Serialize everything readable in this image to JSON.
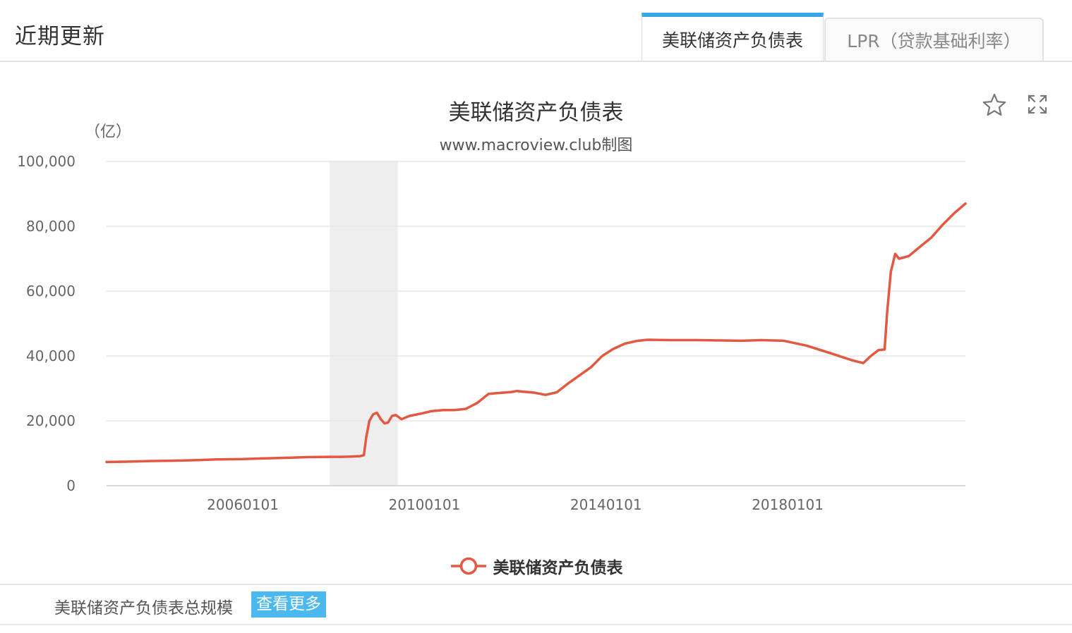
{
  "header": {
    "title": "近期更新",
    "tabs": [
      {
        "label": "美联储资产负债表",
        "active": true
      },
      {
        "label": "LPR（贷款基础利率）",
        "active": false
      }
    ],
    "accent_color": "#3aa6ea"
  },
  "toolbar": {
    "favorite_icon": "star-icon",
    "fullscreen_icon": "expand-icon"
  },
  "chart_data": {
    "type": "line",
    "title": "美联储资产负债表",
    "subtitle": "www.macroview.club制图",
    "unit_label": "（亿）",
    "ylim": [
      0,
      100000
    ],
    "yticks": [
      "100,000",
      "80,000",
      "60,000",
      "40,000",
      "20,000",
      "0"
    ],
    "ytick_values": [
      100000,
      80000,
      60000,
      40000,
      20000,
      0
    ],
    "xlim": [
      "2003-01-01",
      "2021-12-01"
    ],
    "xticks": [
      {
        "label": "20060101",
        "date": "2006-01-01"
      },
      {
        "label": "20100101",
        "date": "2010-01-01"
      },
      {
        "label": "20140101",
        "date": "2014-01-01"
      },
      {
        "label": "20180101",
        "date": "2018-01-01"
      }
    ],
    "shaded_period": {
      "start": "2007-12-01",
      "end": "2009-06-01",
      "color": "#eeeeee"
    },
    "grid": true,
    "series": [
      {
        "name": "美联储资产负债表",
        "color": "#e25841",
        "points": [
          [
            "2003-01-01",
            7300
          ],
          [
            "2003-06-01",
            7400
          ],
          [
            "2004-01-01",
            7600
          ],
          [
            "2004-06-01",
            7700
          ],
          [
            "2005-01-01",
            7900
          ],
          [
            "2005-06-01",
            8100
          ],
          [
            "2006-01-01",
            8200
          ],
          [
            "2006-06-01",
            8400
          ],
          [
            "2007-01-01",
            8600
          ],
          [
            "2007-06-01",
            8800
          ],
          [
            "2007-12-01",
            8900
          ],
          [
            "2008-03-01",
            8900
          ],
          [
            "2008-06-01",
            9000
          ],
          [
            "2008-08-01",
            9100
          ],
          [
            "2008-09-01",
            9400
          ],
          [
            "2008-09-20",
            15000
          ],
          [
            "2008-10-15",
            20000
          ],
          [
            "2008-11-15",
            22000
          ],
          [
            "2008-12-15",
            22500
          ],
          [
            "2009-01-15",
            20500
          ],
          [
            "2009-02-15",
            19200
          ],
          [
            "2009-03-15",
            19500
          ],
          [
            "2009-04-15",
            21500
          ],
          [
            "2009-05-15",
            21800
          ],
          [
            "2009-07-01",
            20500
          ],
          [
            "2009-09-01",
            21500
          ],
          [
            "2009-12-01",
            22200
          ],
          [
            "2010-03-01",
            23000
          ],
          [
            "2010-06-01",
            23300
          ],
          [
            "2010-09-01",
            23300
          ],
          [
            "2010-12-01",
            23700
          ],
          [
            "2011-03-01",
            25500
          ],
          [
            "2011-06-01",
            28300
          ],
          [
            "2011-09-01",
            28600
          ],
          [
            "2011-12-01",
            28900
          ],
          [
            "2012-01-15",
            29200
          ],
          [
            "2012-03-01",
            29000
          ],
          [
            "2012-06-01",
            28700
          ],
          [
            "2012-09-01",
            28000
          ],
          [
            "2012-12-01",
            28800
          ],
          [
            "2013-03-01",
            31500
          ],
          [
            "2013-06-01",
            34000
          ],
          [
            "2013-09-01",
            36500
          ],
          [
            "2013-12-01",
            40000
          ],
          [
            "2014-03-01",
            42200
          ],
          [
            "2014-06-01",
            43800
          ],
          [
            "2014-09-01",
            44600
          ],
          [
            "2014-12-01",
            45000
          ],
          [
            "2015-06-01",
            44900
          ],
          [
            "2016-01-01",
            44900
          ],
          [
            "2016-06-01",
            44800
          ],
          [
            "2017-01-01",
            44700
          ],
          [
            "2017-06-01",
            44900
          ],
          [
            "2017-12-01",
            44700
          ],
          [
            "2018-06-01",
            43200
          ],
          [
            "2018-12-01",
            41000
          ],
          [
            "2019-06-01",
            38700
          ],
          [
            "2019-09-01",
            37800
          ],
          [
            "2019-11-01",
            40000
          ],
          [
            "2020-01-01",
            41800
          ],
          [
            "2020-02-20",
            42000
          ],
          [
            "2020-03-10",
            53000
          ],
          [
            "2020-04-10",
            66000
          ],
          [
            "2020-05-15",
            71500
          ],
          [
            "2020-06-15",
            70000
          ],
          [
            "2020-09-01",
            70800
          ],
          [
            "2020-12-01",
            73700
          ],
          [
            "2021-03-01",
            76500
          ],
          [
            "2021-06-01",
            80500
          ],
          [
            "2021-09-01",
            84000
          ],
          [
            "2021-12-01",
            87000
          ]
        ]
      }
    ]
  },
  "legend": {
    "label": "美联储资产负债表"
  },
  "footer": {
    "caption": "美联储资产负债表总规模",
    "more_button": "查看更多",
    "button_color": "#4cb9ee"
  }
}
